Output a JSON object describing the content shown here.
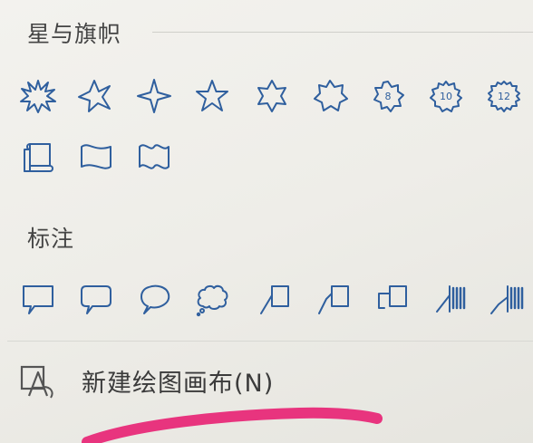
{
  "sections": {
    "stars": {
      "title": "星与旗帜",
      "shapes": [
        {
          "name": "explosion-1"
        },
        {
          "name": "star-4-point"
        },
        {
          "name": "star-4-point-sparkle"
        },
        {
          "name": "star-5-point"
        },
        {
          "name": "star-6-point"
        },
        {
          "name": "star-7-point"
        },
        {
          "name": "star-8-point",
          "label": "8"
        },
        {
          "name": "star-10-point",
          "label": "10"
        },
        {
          "name": "star-12-point",
          "label": "12"
        },
        {
          "name": "scroll-vertical"
        },
        {
          "name": "wave-banner"
        },
        {
          "name": "double-wave-banner"
        }
      ]
    },
    "callouts": {
      "title": "标注",
      "shapes": [
        {
          "name": "rect-callout"
        },
        {
          "name": "rounded-rect-callout"
        },
        {
          "name": "oval-callout"
        },
        {
          "name": "cloud-callout"
        },
        {
          "name": "line-callout-1"
        },
        {
          "name": "line-callout-2"
        },
        {
          "name": "line-callout-3"
        },
        {
          "name": "line-callout-accent-bar"
        },
        {
          "name": "line-callout-accent-bar-2"
        }
      ]
    }
  },
  "menu": {
    "new_canvas_label": "新建绘图画布(N)",
    "new_canvas_icon": "canvas-pen-icon"
  },
  "colors": {
    "shape_stroke": "#2f5f9e",
    "highlight": "#e8347e"
  }
}
